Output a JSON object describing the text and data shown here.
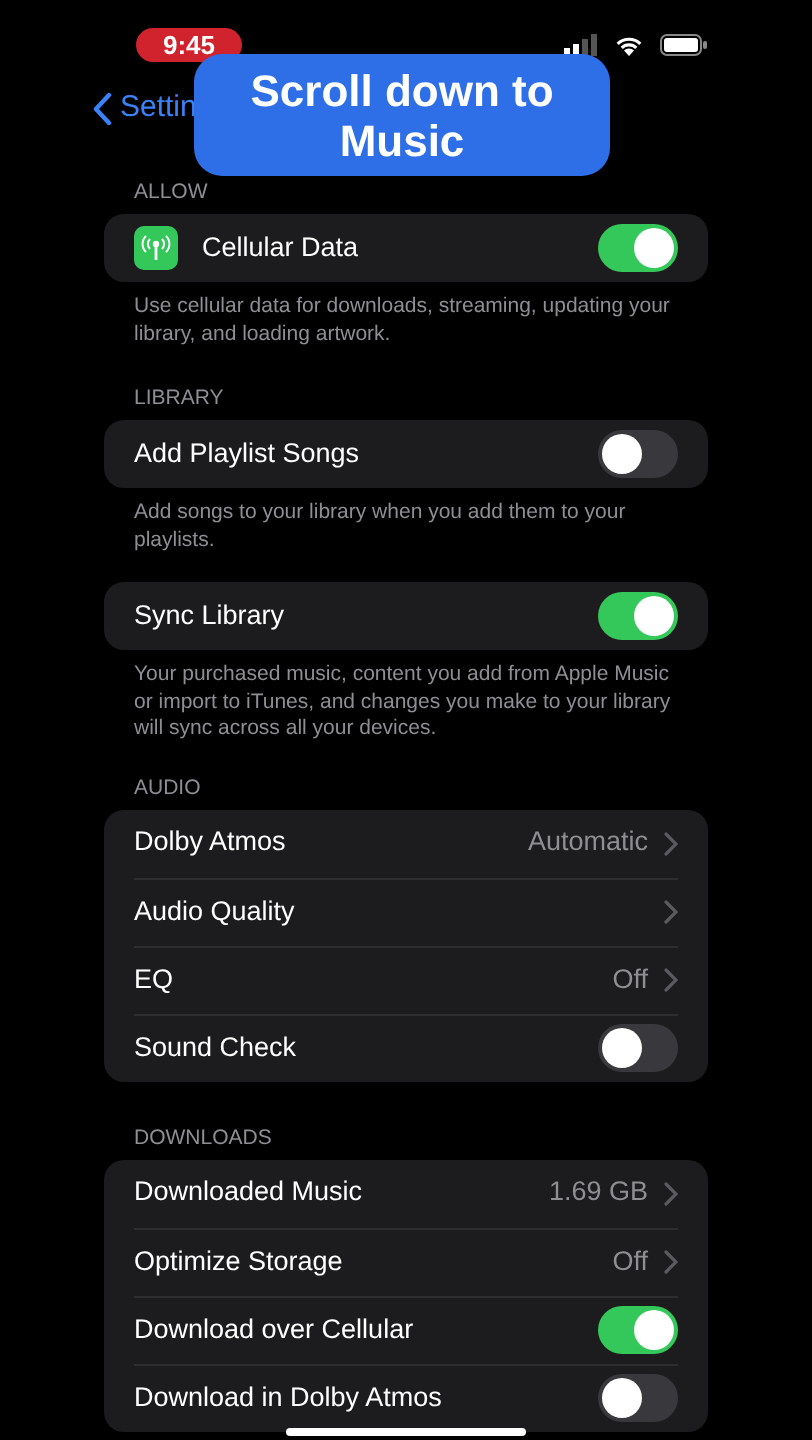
{
  "status_bar": {
    "time": "9:45"
  },
  "nav": {
    "back": "Settin"
  },
  "caption": {
    "text": "Scroll down to Music"
  },
  "sections": [
    {
      "header": "ALLOW",
      "rows": [
        {
          "kind": "icon-toggle",
          "label": "Cellular Data",
          "on": true
        }
      ],
      "footer": "Use cellular data for downloads, streaming, updating your library, and loading artwork."
    },
    {
      "header": "LIBRARY",
      "rows": [
        {
          "kind": "toggle",
          "label": "Add Playlist Songs",
          "on": false
        }
      ],
      "footer": "Add songs to your library when you add them to your playlists."
    },
    {
      "rows": [
        {
          "kind": "toggle",
          "label": "Sync Library",
          "on": true
        }
      ],
      "footer": "Your purchased music, content you add from Apple Music or import to iTunes, and changes you make to your library will sync across all your devices."
    },
    {
      "header": "AUDIO",
      "rows": [
        {
          "kind": "detail",
          "label": "Dolby Atmos",
          "value": "Automatic"
        },
        {
          "kind": "detail",
          "label": "Audio Quality"
        },
        {
          "kind": "detail",
          "label": "EQ",
          "value": "Off"
        },
        {
          "kind": "toggle",
          "label": "Sound Check",
          "on": false
        }
      ]
    },
    {
      "header": "DOWNLOADS",
      "rows": [
        {
          "kind": "detail",
          "label": "Downloaded Music",
          "value": "1.69 GB"
        },
        {
          "kind": "detail",
          "label": "Optimize Storage",
          "value": "Off"
        },
        {
          "kind": "toggle",
          "label": "Download over Cellular",
          "on": true
        },
        {
          "kind": "toggle",
          "label": "Download in Dolby Atmos",
          "on": false
        }
      ]
    }
  ]
}
